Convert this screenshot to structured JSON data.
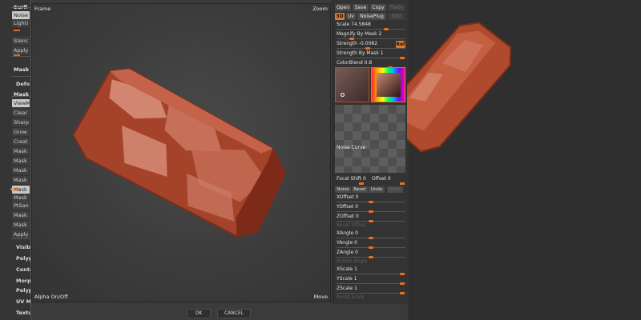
{
  "left_panel": {
    "items": [
      {
        "label": "Surfi",
        "style": "bold"
      },
      {
        "label": "Noise",
        "style": "on"
      },
      {
        "label": "Lighti",
        "style": "plain"
      },
      {
        "label": "Stenc",
        "style": "plain"
      },
      {
        "label": "Apply",
        "style": "plain"
      },
      {
        "label": "Mask",
        "style": "bold"
      },
      {
        "label": "Defo",
        "style": "head"
      },
      {
        "label": "Mask",
        "style": "bold"
      },
      {
        "label": "ViewM",
        "style": "on"
      },
      {
        "label": "Clear",
        "style": "plain"
      },
      {
        "label": "Sharp",
        "style": "plain"
      },
      {
        "label": "Grow",
        "style": "plain"
      },
      {
        "label": "Creat",
        "style": "plain"
      },
      {
        "label": "Mask",
        "style": "plain"
      },
      {
        "label": "Mask",
        "style": "plain"
      },
      {
        "label": "Mask",
        "style": "plain"
      },
      {
        "label": "Mask",
        "style": "plain"
      },
      {
        "label": "Mask",
        "style": "on"
      },
      {
        "label": "Mask",
        "style": "plain"
      },
      {
        "label": "PtSan",
        "style": "plain"
      },
      {
        "label": "Mask",
        "style": "plain"
      },
      {
        "label": "Mask",
        "style": "plain"
      },
      {
        "label": "Apply",
        "style": "plain"
      },
      {
        "label": "Visib",
        "style": "head"
      },
      {
        "label": "Polyg",
        "style": "head"
      },
      {
        "label": "Conta",
        "style": "head"
      },
      {
        "label": "Morph",
        "style": "head"
      },
      {
        "label": "Polyp",
        "style": "head"
      },
      {
        "label": "UV M",
        "style": "head"
      },
      {
        "label": "Textu",
        "style": "head"
      }
    ]
  },
  "viewport": {
    "frame_label": "Frame",
    "zoom_label": "Zoom",
    "alpha_label": "Alpha On/Off",
    "move_label": "Move"
  },
  "right_col": {
    "top_buttons": [
      "Open",
      "Save",
      "Copy",
      "Paste"
    ],
    "mode_buttons": [
      "3D",
      "Uv",
      "NoisePlug",
      "Edit"
    ],
    "sliders_a": [
      {
        "label": "Scale 74.5848",
        "value": 0.74
      },
      {
        "label": "Magnify By Mask 2",
        "value": 0.2
      },
      {
        "label": "Strength -0.0082",
        "value": 0.45
      },
      {
        "label": "Strength By Mask 1",
        "value": 0.99
      },
      {
        "label": "ColorBlend 0.8",
        "value": 0.8
      }
    ],
    "ref_button": "Ref",
    "curve_label": "Noise Curve",
    "focal_shift": "Focal Shift",
    "focal_shift_value": "0",
    "offset_label": "Offset 0",
    "curve_buttons": [
      "Noise",
      "Reset",
      "Undo",
      "Redo"
    ],
    "sliders_b": [
      {
        "label": "XOffset 0",
        "value": 0.5
      },
      {
        "label": "YOffset 0",
        "value": 0.5
      },
      {
        "label": "ZOffset 0",
        "value": 0.5
      }
    ],
    "reset_offset": "Reset Offset",
    "sliders_c": [
      {
        "label": "XAngle 0",
        "value": 0.5
      },
      {
        "label": "YAngle 0",
        "value": 0.5
      },
      {
        "label": "ZAngle 0",
        "value": 0.5
      }
    ],
    "rotate_angle": "Rotate Angle",
    "sliders_d": [
      {
        "label": "XScale 1",
        "value": 0.99
      },
      {
        "label": "YScale 1",
        "value": 0.99
      },
      {
        "label": "ZScale 1",
        "value": 0.99
      }
    ],
    "reset_scale": "Reset Scale"
  },
  "footer": {
    "ok_label": "OK",
    "cancel_label": "CANCEL"
  },
  "colors": {
    "accent": "#e57224",
    "mesh": "#b4492a",
    "mesh_light": "#d98a72"
  }
}
